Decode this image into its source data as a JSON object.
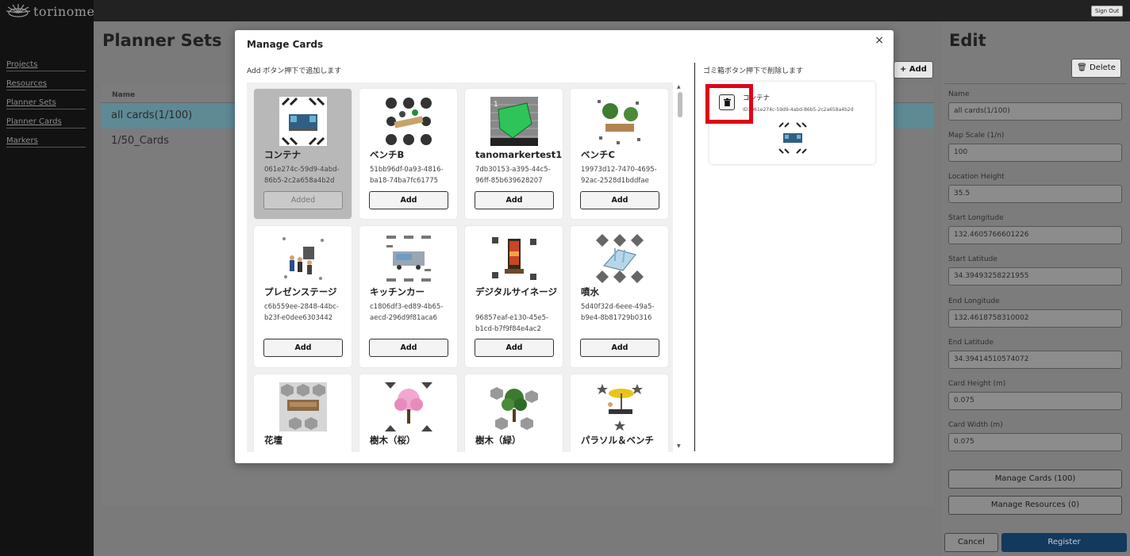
{
  "app": {
    "logo_text": "torinome",
    "sign_out": "Sign Out"
  },
  "sidebar": {
    "items": [
      {
        "label": "Projects"
      },
      {
        "label": "Resources"
      },
      {
        "label": "Planner Sets"
      },
      {
        "label": "Planner Cards"
      },
      {
        "label": "Markers"
      }
    ]
  },
  "main": {
    "title": "Planner Sets",
    "add_label": "+ Add",
    "column_name": "Name",
    "rows": [
      {
        "name": "all cards(1/100)"
      },
      {
        "name": "1/50_Cards"
      }
    ]
  },
  "edit": {
    "title": "Edit",
    "delete_label": "Delete",
    "fields": [
      {
        "label": "Name",
        "value": "all cards(1/100)"
      },
      {
        "label": "Map Scale (1/n)",
        "value": "100"
      },
      {
        "label": "Location Height",
        "value": "35.5"
      },
      {
        "label": "Start Longitude",
        "value": "132.4605766601226"
      },
      {
        "label": "Start Latitude",
        "value": "34.39493258221955"
      },
      {
        "label": "End Longitude",
        "value": "132.4618758310002"
      },
      {
        "label": "End Latitude",
        "value": "34.39414510574072"
      },
      {
        "label": "Card Height (m)",
        "value": "0.075"
      },
      {
        "label": "Card Width (m)",
        "value": "0.075"
      }
    ],
    "manage_cards": "Manage Cards (100)",
    "manage_resources": "Manage Resources (0)",
    "cancel": "Cancel",
    "register": "Register"
  },
  "modal": {
    "title": "Manage Cards",
    "close": "×",
    "left_hint": "Add ボタン押下で追加します",
    "right_hint": "ゴミ箱ボタン押下で削除します",
    "cards": [
      {
        "name": "コンテナ",
        "id1": "061e274c-59d9-4abd-",
        "id2": "86b5-2c2a658a4b2d",
        "button": "Added",
        "added": true
      },
      {
        "name": "ベンチB",
        "id1": "51bb96df-0a93-4816-",
        "id2": "ba18-74ba7fc61775",
        "button": "Add"
      },
      {
        "name": "tanomarkertest1",
        "id1": "7db30153-a395-44c5-",
        "id2": "96ff-85b639628207",
        "button": "Add"
      },
      {
        "name": "ベンチC",
        "id1": "19973d12-7470-4695-",
        "id2": "92ac-2528d1bddfae",
        "button": "Add"
      },
      {
        "name": "プレゼンステージ",
        "id1": "c6b559ee-2848-44bc-",
        "id2": "b23f-e0dee6303442",
        "button": "Add"
      },
      {
        "name": "キッチンカー",
        "id1": "c1806df3-ed89-4b65-",
        "id2": "aecd-296d9f81aca6",
        "button": "Add"
      },
      {
        "name": "デジタルサイネージ",
        "id1": "96857eaf-e130-45e5-",
        "id2": "b1cd-b7f9f84e4ac2",
        "button": "Add"
      },
      {
        "name": "噴水",
        "id1": "5d40f32d-6eee-49a5-",
        "id2": "b9e4-8b81729b0316",
        "button": "Add"
      },
      {
        "name": "花壇"
      },
      {
        "name": "樹木（桜）"
      },
      {
        "name": "樹木（緑）"
      },
      {
        "name": "パラソル＆ベンチ"
      }
    ],
    "selected": {
      "name": "コンテナ",
      "id": "ID: 061e274c-59d9-4abd-86b5-2c2a658a4b2d"
    }
  },
  "colors": {
    "highlight": "#e0001a",
    "active_row": "#5e8a95",
    "register": "#123a5e"
  }
}
